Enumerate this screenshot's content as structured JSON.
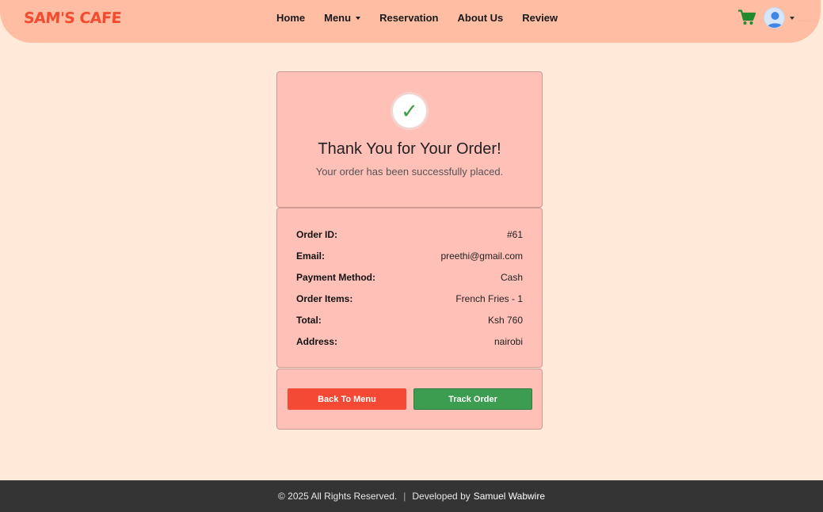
{
  "brand": "SAM'S CAFE",
  "nav": {
    "home": "Home",
    "menu": "Menu",
    "reservation": "Reservation",
    "about": "About Us",
    "review": "Review"
  },
  "header_icons": {
    "cart": "shopping-cart-icon",
    "avatar": "user-avatar-icon",
    "avatar_text": "……"
  },
  "confirmation": {
    "icon": "checkmark",
    "check_glyph": "✓",
    "title": "Thank You for Your Order!",
    "subtitle": "Your order has been successfully placed."
  },
  "details": [
    {
      "label": "Order ID:",
      "value": "#61"
    },
    {
      "label": "Email:",
      "value": "preethi@gmail.com"
    },
    {
      "label": "Payment Method:",
      "value": "Cash"
    },
    {
      "label": "Order Items:",
      "value": "French Fries - 1"
    },
    {
      "label": "Total:",
      "value": "Ksh 760"
    },
    {
      "label": "Address:",
      "value": "nairobi"
    }
  ],
  "actions": {
    "back": "Back To Menu",
    "track": "Track Order"
  },
  "footer": {
    "copyright": "© 2025 All Rights Reserved.",
    "separator": "|",
    "developed_by": "Developed by",
    "developer": "Samuel Wabwire"
  },
  "colors": {
    "background": "#ffeada",
    "navbar": "#ffbda4",
    "brand": "#f44a2e",
    "card": "#ffc0b8",
    "back_button": "#f44a35",
    "track_button": "#3c9d50",
    "footer": "#343434"
  }
}
